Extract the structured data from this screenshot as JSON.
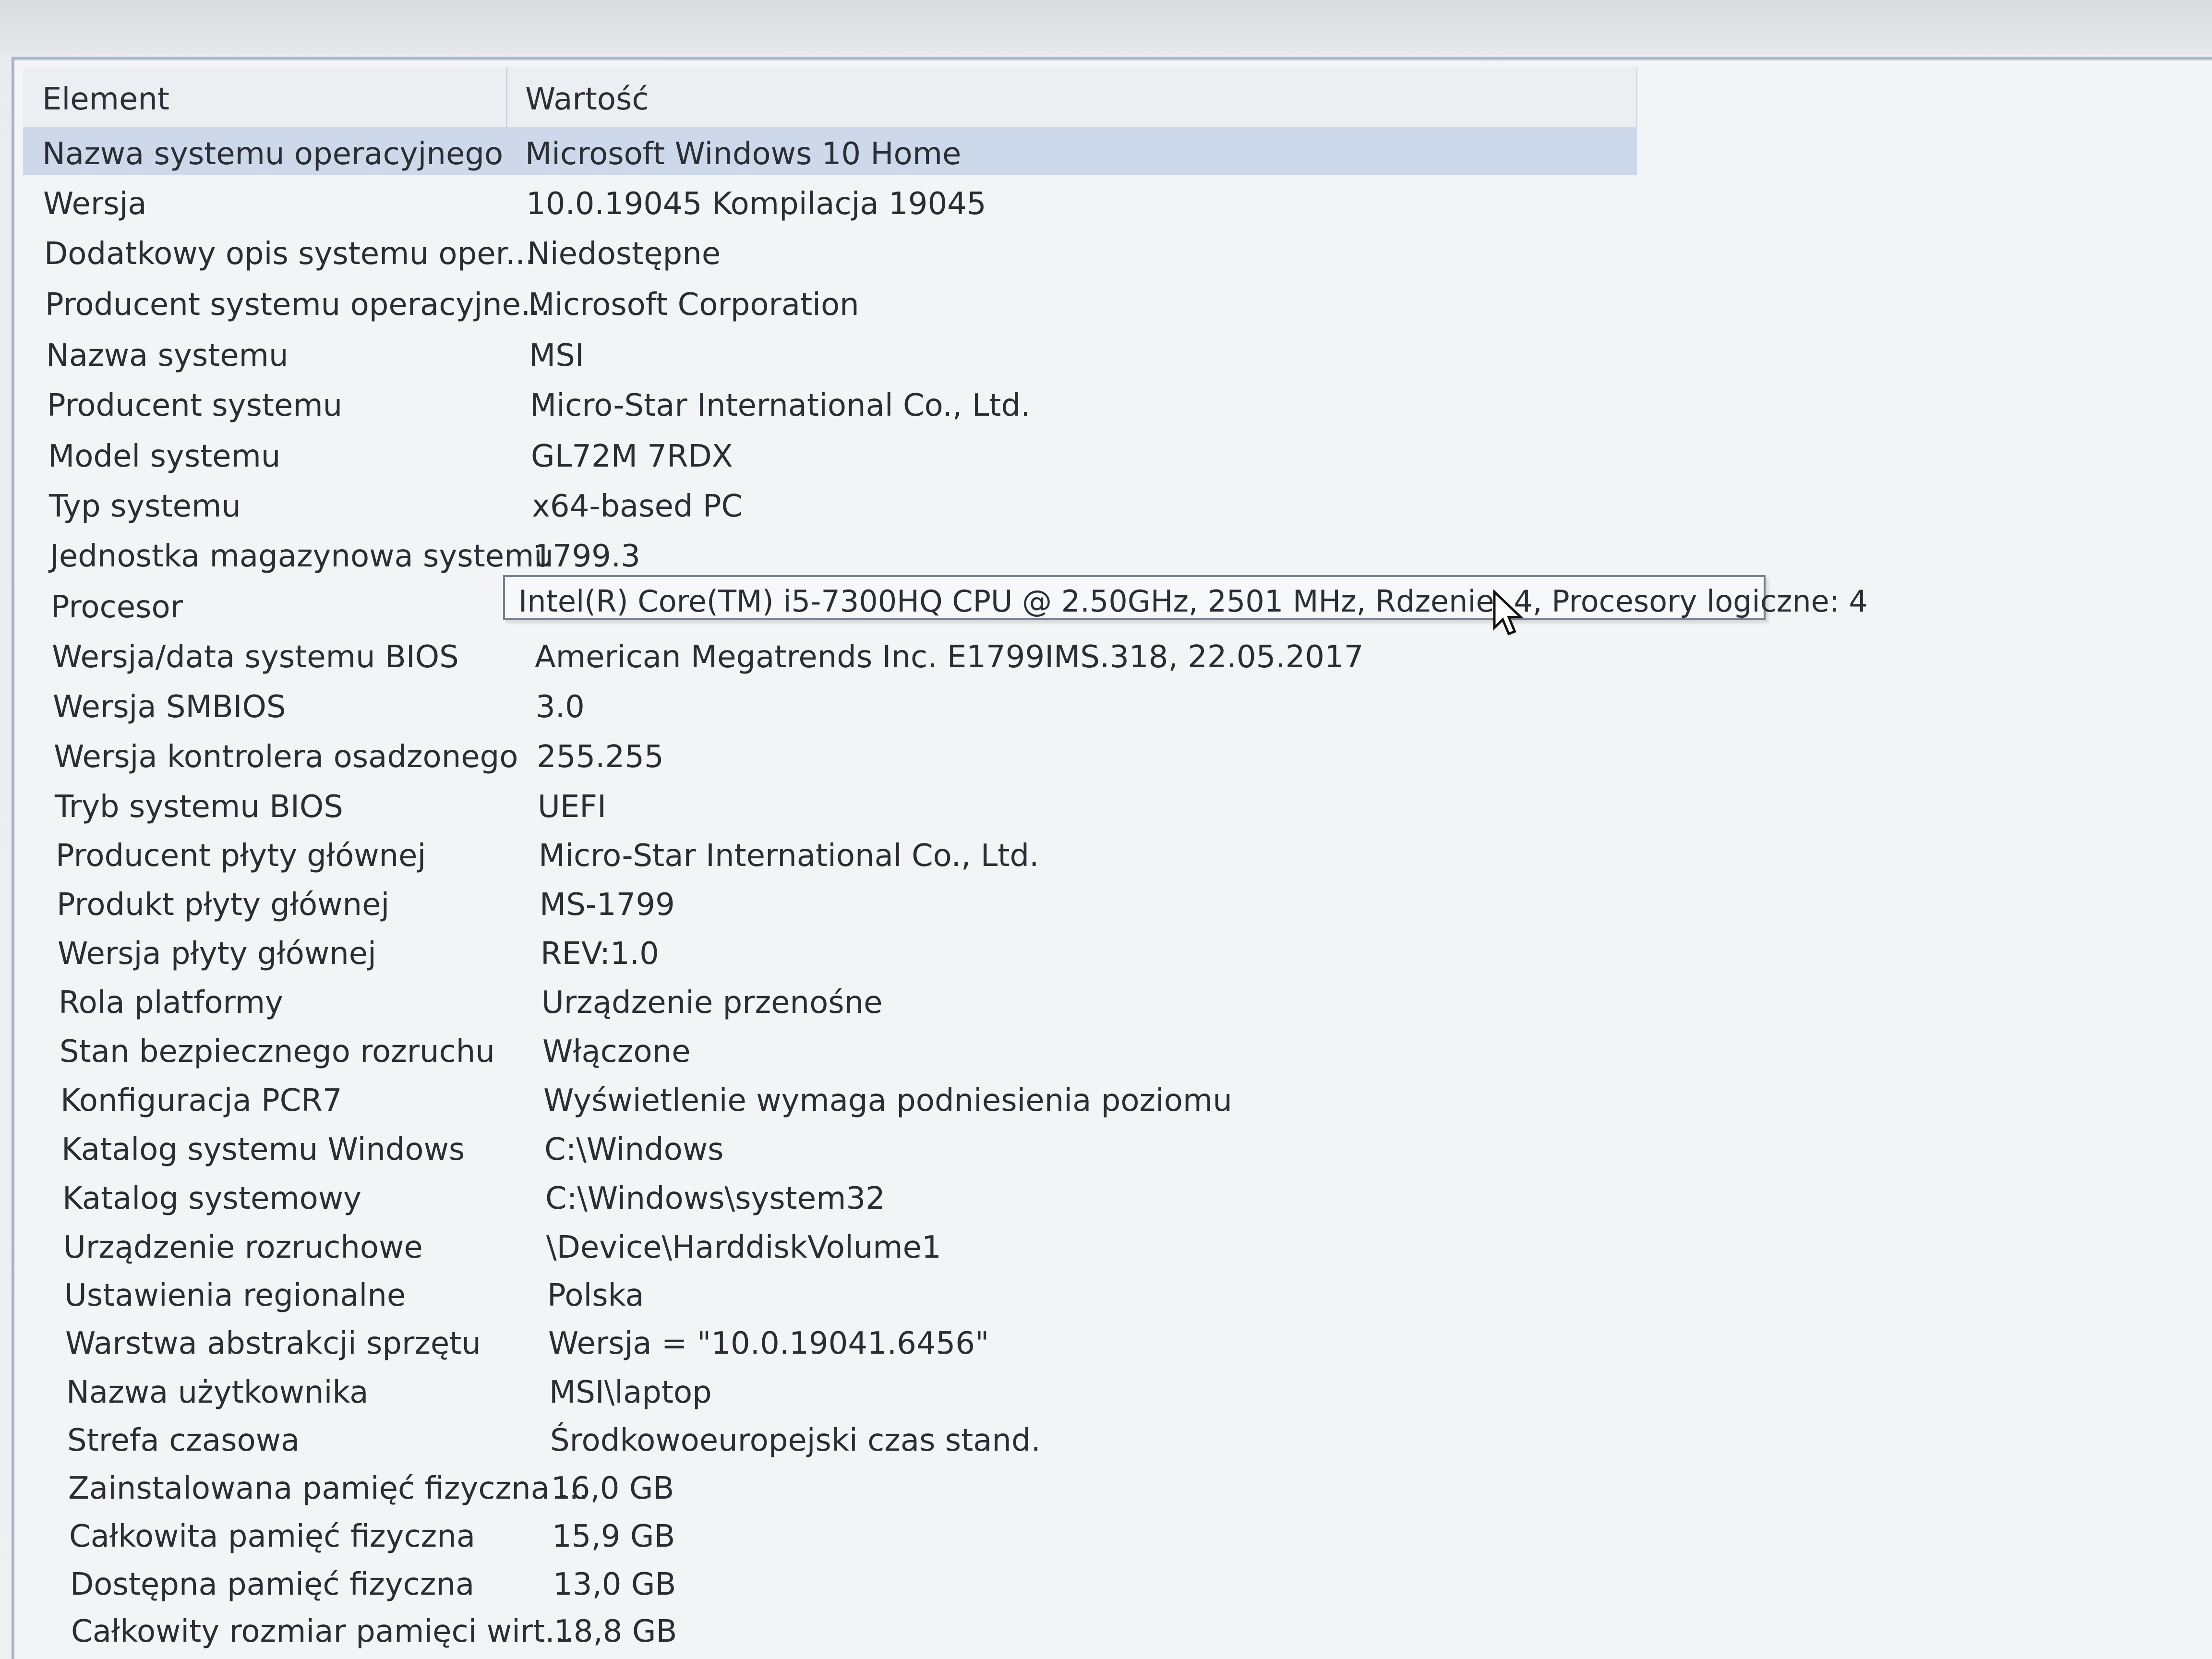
{
  "header": {
    "col_element": "Element",
    "col_value": "Wartość"
  },
  "rows": [
    {
      "element": "Nazwa systemu operacyjnego",
      "value": "Microsoft Windows 10 Home"
    },
    {
      "element": "Wersja",
      "value": "10.0.19045 Kompilacja 19045"
    },
    {
      "element": "Dodatkowy opis systemu oper...",
      "value": "Niedostępne"
    },
    {
      "element": "Producent systemu operacyjne...",
      "value": "Microsoft Corporation"
    },
    {
      "element": "Nazwa systemu",
      "value": "MSI"
    },
    {
      "element": "Producent systemu",
      "value": "Micro-Star International Co., Ltd."
    },
    {
      "element": "Model systemu",
      "value": "GL72M 7RDX"
    },
    {
      "element": "Typ systemu",
      "value": "x64-based PC"
    },
    {
      "element": "Jednostka magazynowa systemu",
      "value": "1799.3"
    },
    {
      "element": "Procesor",
      "value": ""
    },
    {
      "element": "Wersja/data systemu BIOS",
      "value": "American Megatrends Inc. E1799IMS.318, 22.05.2017"
    },
    {
      "element": "Wersja SMBIOS",
      "value": "3.0"
    },
    {
      "element": "Wersja kontrolera osadzonego",
      "value": "255.255"
    },
    {
      "element": "Tryb systemu BIOS",
      "value": "UEFI"
    },
    {
      "element": "Producent płyty głównej",
      "value": "Micro-Star International Co., Ltd."
    },
    {
      "element": "Produkt płyty głównej",
      "value": "MS-1799"
    },
    {
      "element": "Wersja płyty głównej",
      "value": "REV:1.0"
    },
    {
      "element": "Rola platformy",
      "value": "Urządzenie przenośne"
    },
    {
      "element": "Stan bezpiecznego rozruchu",
      "value": "Włączone"
    },
    {
      "element": "Konfiguracja PCR7",
      "value": "Wyświetlenie wymaga podniesienia poziomu"
    },
    {
      "element": "Katalog systemu Windows",
      "value": "C:\\Windows"
    },
    {
      "element": "Katalog systemowy",
      "value": "C:\\Windows\\system32"
    },
    {
      "element": "Urządzenie rozruchowe",
      "value": "\\Device\\HarddiskVolume1"
    },
    {
      "element": "Ustawienia regionalne",
      "value": "Polska"
    },
    {
      "element": "Warstwa abstrakcji sprzętu",
      "value": "Wersja = \"10.0.19041.6456\""
    },
    {
      "element": "Nazwa użytkownika",
      "value": "MSI\\laptop"
    },
    {
      "element": "Strefa czasowa",
      "value": "Środkowoeuropejski czas stand."
    },
    {
      "element": "Zainstalowana pamięć fizyczna ...",
      "value": "16,0 GB"
    },
    {
      "element": "Całkowita pamięć fizyczna",
      "value": "15,9 GB"
    },
    {
      "element": "Dostępna pamięć fizyczna",
      "value": "13,0 GB"
    },
    {
      "element": "Całkowity rozmiar pamięci wirt...",
      "value": "18,8 GB"
    }
  ],
  "tooltip": {
    "text": "Intel(R) Core(TM) i5-7300HQ CPU @ 2.50GHz, 2501 MHz, Rdzenie: 4, Procesory logiczne: 4"
  },
  "colors": {
    "selection": "#cdd8ea",
    "text": "#2a2d34"
  }
}
